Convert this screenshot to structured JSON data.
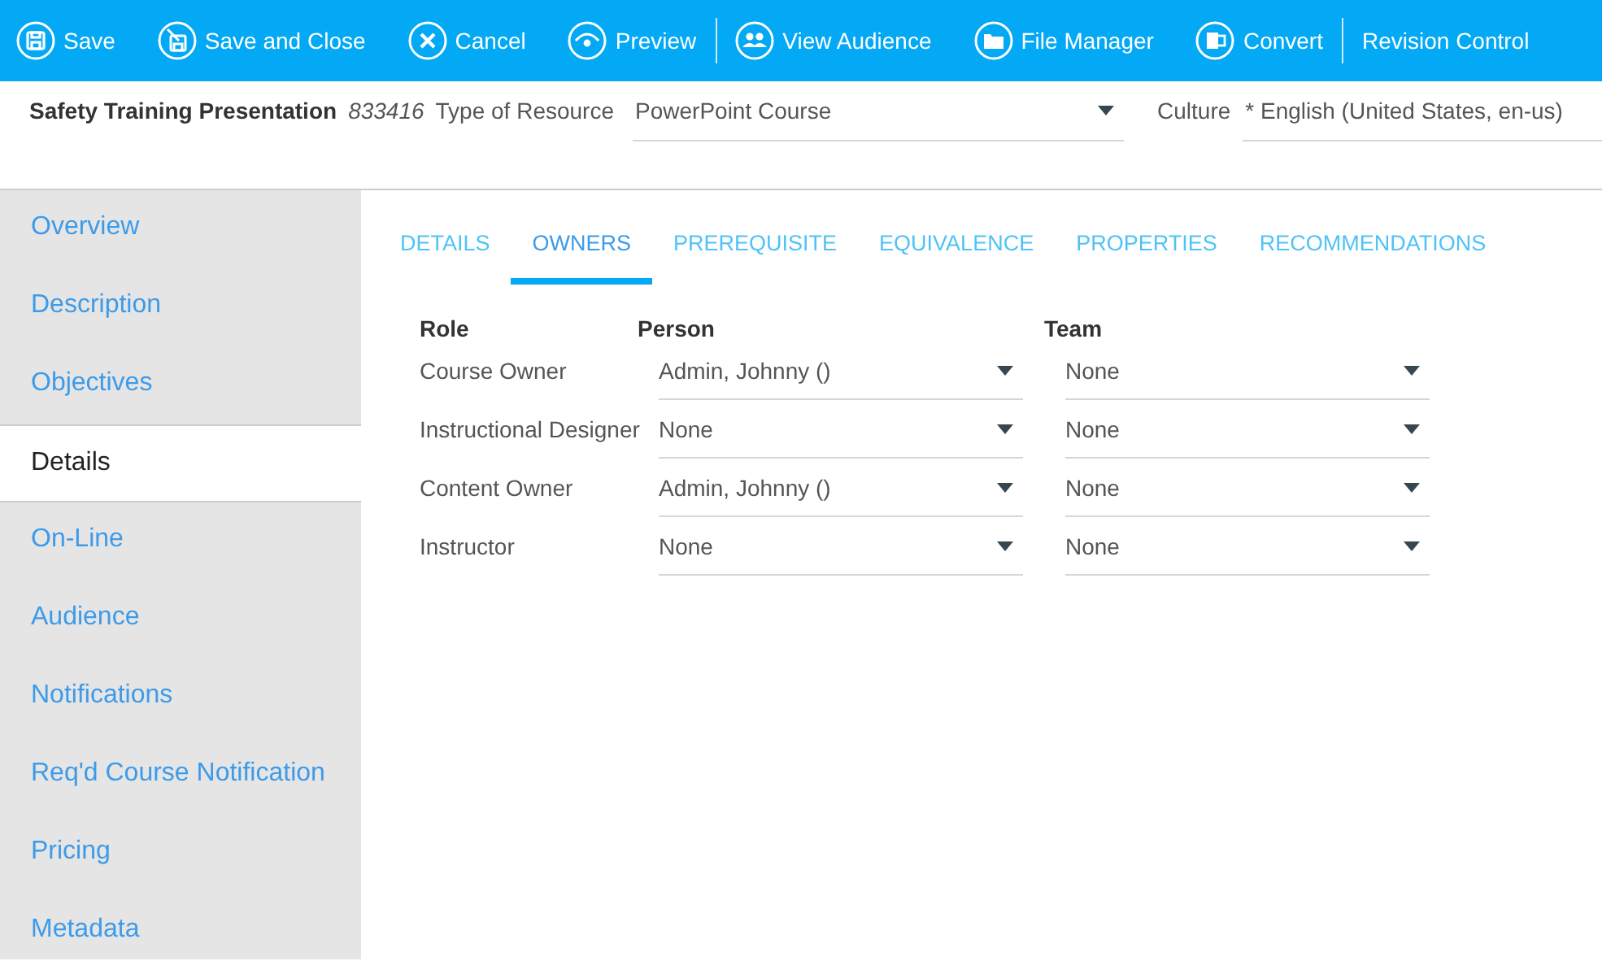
{
  "toolbar": {
    "groups": [
      [
        {
          "label": "Save",
          "kind": "save"
        },
        {
          "label": "Save and Close",
          "kind": "saveclose"
        },
        {
          "label": "Cancel",
          "kind": "cancel"
        },
        {
          "label": "Preview",
          "kind": "preview"
        }
      ],
      [
        {
          "label": "View Audience",
          "kind": "audience"
        },
        {
          "label": "File Manager",
          "kind": "folder"
        },
        {
          "label": "Convert",
          "kind": "convert"
        }
      ],
      [
        {
          "label": "Revision Control",
          "kind": "link"
        }
      ]
    ]
  },
  "header": {
    "title": "Safety Training Presentation",
    "number": "833416",
    "type_label": "Type of Resource",
    "type_value": "PowerPoint Course",
    "culture_label": "Culture",
    "culture_value": "* English (United States, en-us)"
  },
  "sidebar": {
    "items": [
      {
        "label": "Overview",
        "selected": false
      },
      {
        "label": "Description",
        "selected": false
      },
      {
        "label": "Objectives",
        "selected": false
      },
      {
        "label": "Details",
        "selected": true
      },
      {
        "label": "On-Line",
        "selected": false
      },
      {
        "label": "Audience",
        "selected": false
      },
      {
        "label": "Notifications",
        "selected": false
      },
      {
        "label": "Req'd Course Notification",
        "selected": false
      },
      {
        "label": "Pricing",
        "selected": false
      },
      {
        "label": "Metadata",
        "selected": false
      }
    ]
  },
  "tabs": [
    {
      "label": "DETAILS",
      "selected": false
    },
    {
      "label": "OWNERS",
      "selected": true
    },
    {
      "label": "PREREQUISITE",
      "selected": false
    },
    {
      "label": "EQUIVALENCE",
      "selected": false
    },
    {
      "label": "PROPERTIES",
      "selected": false
    },
    {
      "label": "RECOMMENDATIONS",
      "selected": false
    }
  ],
  "owners": {
    "columns": [
      "Role",
      "Person",
      "Team"
    ],
    "rows": [
      {
        "role": "Course Owner",
        "person": "Admin, Johnny ()",
        "team": "None"
      },
      {
        "role": "Instructional Designer",
        "person": "None",
        "team": "None"
      },
      {
        "role": "Content Owner",
        "person": "Admin, Johnny ()",
        "team": "None"
      },
      {
        "role": "Instructor",
        "person": "None",
        "team": "None"
      }
    ]
  }
}
